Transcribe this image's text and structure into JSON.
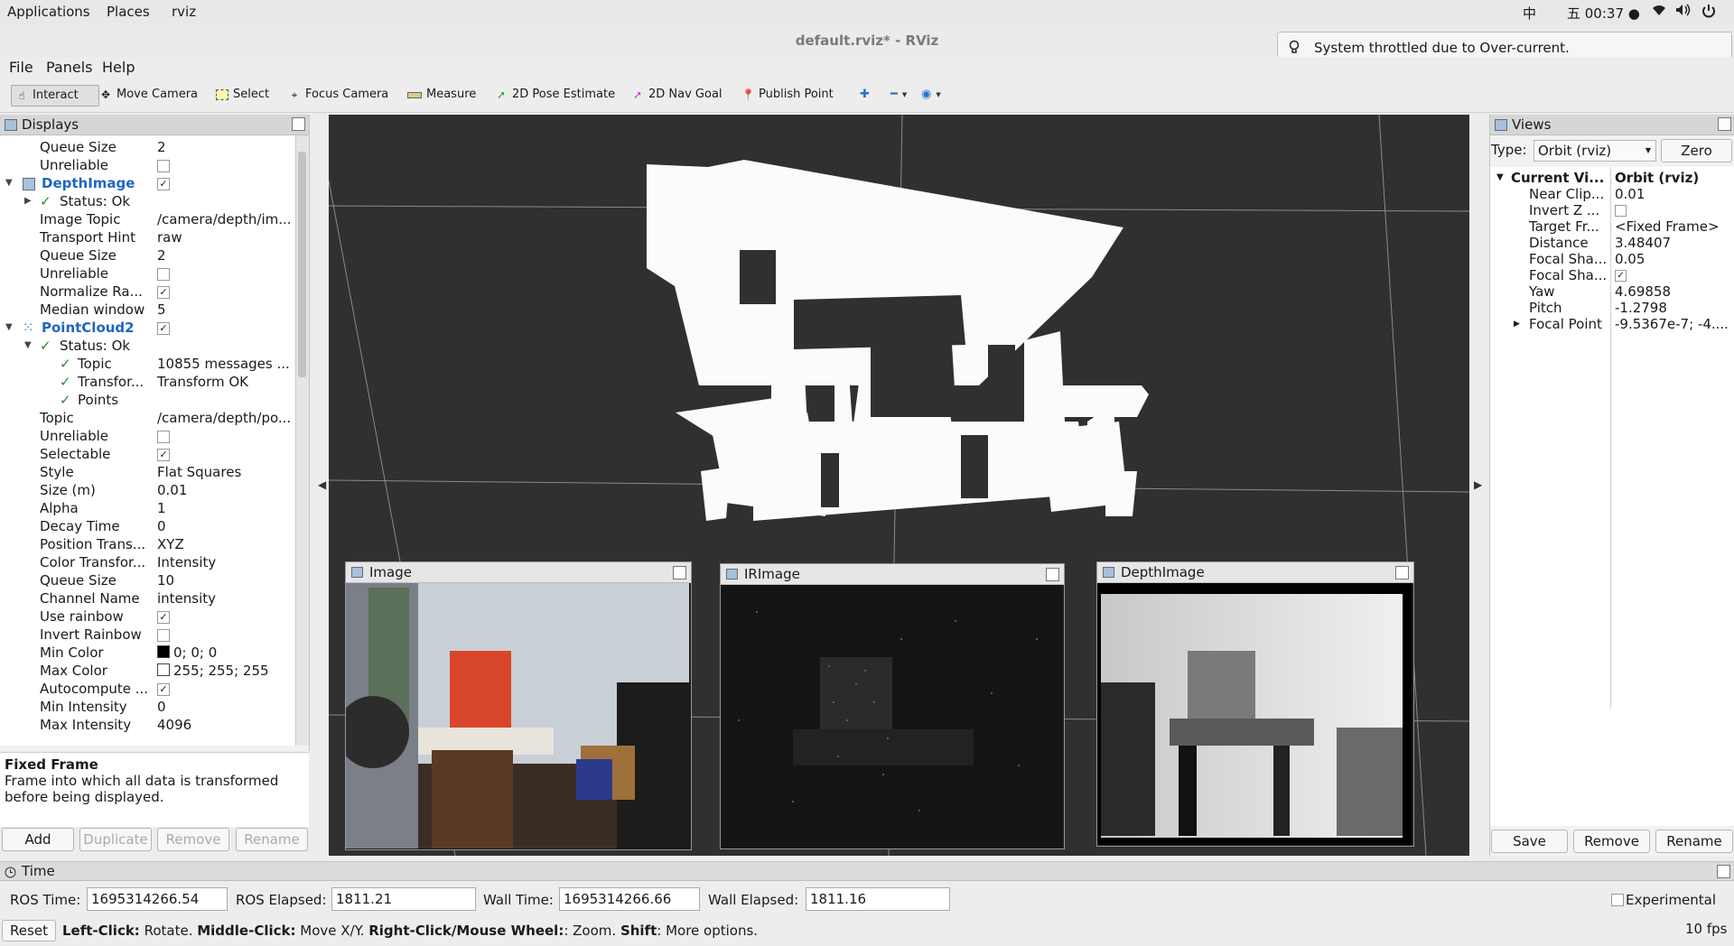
{
  "topbar": {
    "menus": [
      "Applications",
      "Places",
      "rviz"
    ],
    "input_method": "中",
    "clock": "五 00:37 ●"
  },
  "window": {
    "title": "default.rviz* - RViz"
  },
  "notification": {
    "text": "System throttled due to Over-current."
  },
  "menubar": [
    "File",
    "Panels",
    "Help"
  ],
  "toolbar": {
    "interact": "Interact",
    "move_camera": "Move Camera",
    "select": "Select",
    "focus_camera": "Focus Camera",
    "measure": "Measure",
    "pose_estimate": "2D Pose Estimate",
    "nav_goal": "2D Nav Goal",
    "publish_point": "Publish Point"
  },
  "displays": {
    "title": "Displays",
    "rows": [
      {
        "k": "Queue Size",
        "v": "2"
      },
      {
        "k": "Unreliable",
        "v": ""
      },
      {
        "k": "DepthImage",
        "v": "✓"
      },
      {
        "k": "Status: Ok",
        "v": ""
      },
      {
        "k": "Image Topic",
        "v": "/camera/depth/im..."
      },
      {
        "k": "Transport Hint",
        "v": "raw"
      },
      {
        "k": "Queue Size",
        "v": "2"
      },
      {
        "k": "Unreliable",
        "v": ""
      },
      {
        "k": "Normalize Ra...",
        "v": "✓"
      },
      {
        "k": "Median window",
        "v": "5"
      },
      {
        "k": "PointCloud2",
        "v": "✓"
      },
      {
        "k": "Status: Ok",
        "v": ""
      },
      {
        "k": "Topic",
        "v": "10855 messages ..."
      },
      {
        "k": "Transfor...",
        "v": "Transform OK"
      },
      {
        "k": "Points",
        "v": ""
      },
      {
        "k": "Topic",
        "v": "/camera/depth/po..."
      },
      {
        "k": "Unreliable",
        "v": ""
      },
      {
        "k": "Selectable",
        "v": "✓"
      },
      {
        "k": "Style",
        "v": "Flat Squares"
      },
      {
        "k": "Size (m)",
        "v": "0.01"
      },
      {
        "k": "Alpha",
        "v": "1"
      },
      {
        "k": "Decay Time",
        "v": "0"
      },
      {
        "k": "Position Trans...",
        "v": "XYZ"
      },
      {
        "k": "Color Transfor...",
        "v": "Intensity"
      },
      {
        "k": "Queue Size",
        "v": "10"
      },
      {
        "k": "Channel Name",
        "v": "intensity"
      },
      {
        "k": "Use rainbow",
        "v": "✓"
      },
      {
        "k": "Invert Rainbow",
        "v": ""
      },
      {
        "k": "Min Color",
        "v": "0; 0; 0"
      },
      {
        "k": "Max Color",
        "v": "255; 255; 255"
      },
      {
        "k": "Autocompute ...",
        "v": "✓"
      },
      {
        "k": "Min Intensity",
        "v": "0"
      },
      {
        "k": "Max Intensity",
        "v": "4096"
      }
    ],
    "help_title": "Fixed Frame",
    "help_text_1": "Frame into which all data is transformed",
    "help_text_2": "before being displayed.",
    "buttons": {
      "add": "Add",
      "duplicate": "Duplicate",
      "remove": "Remove",
      "rename": "Rename"
    }
  },
  "viewport": {
    "image_title": "Image",
    "ir_title": "IRImage",
    "depth_title": "DepthImage"
  },
  "views": {
    "title": "Views",
    "type_label": "Type:",
    "type_value": "Orbit (rviz)",
    "zero": "Zero",
    "current_key": "Current Vi...",
    "current_val": "Orbit (rviz)",
    "rows": [
      {
        "k": "Near Clip...",
        "v": "0.01"
      },
      {
        "k": "Invert Z ...",
        "v": ""
      },
      {
        "k": "Target Fr...",
        "v": "<Fixed Frame>"
      },
      {
        "k": "Distance",
        "v": "3.48407"
      },
      {
        "k": "Focal Sha...",
        "v": "0.05"
      },
      {
        "k": "Focal Sha...",
        "v": "✓"
      },
      {
        "k": "Yaw",
        "v": "4.69858"
      },
      {
        "k": "Pitch",
        "v": "-1.2798"
      },
      {
        "k": "Focal Point",
        "v": "-9.5367e-7; -4...."
      }
    ],
    "buttons": {
      "save": "Save",
      "remove": "Remove",
      "rename": "Rename"
    }
  },
  "time": {
    "title": "Time",
    "ros_time_label": "ROS Time:",
    "ros_time": "1695314266.54",
    "ros_elapsed_label": "ROS Elapsed:",
    "ros_elapsed": "1811.21",
    "wall_time_label": "Wall Time:",
    "wall_time": "1695314266.66",
    "wall_elapsed_label": "Wall Elapsed:",
    "wall_elapsed": "1811.16",
    "experimental": "Experimental",
    "reset": "Reset",
    "fps": "10 fps",
    "hint": {
      "lc": "Left-Click:",
      "lc_t": " Rotate. ",
      "mc": "Middle-Click:",
      "mc_t": " Move X/Y. ",
      "rc": "Right-Click/Mouse Wheel:",
      "rc_t": ": Zoom. ",
      "sh": "Shift",
      "sh_t": ": More options."
    }
  }
}
